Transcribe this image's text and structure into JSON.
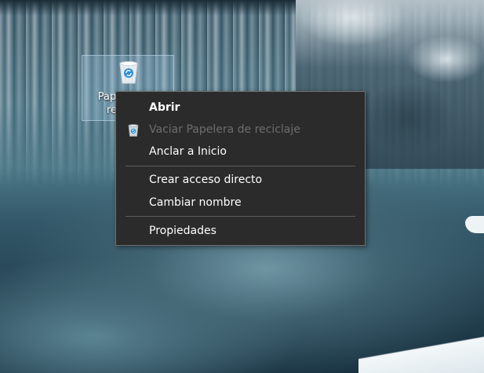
{
  "desktop": {
    "icon": {
      "name": "recycle-bin",
      "label": "Papelera de reciclaje"
    }
  },
  "context_menu": {
    "items": [
      {
        "label": "Abrir",
        "bold": true,
        "enabled": true
      },
      {
        "label": "Vaciar Papelera de reciclaje",
        "enabled": false,
        "icon": "recycle-bin-icon"
      },
      {
        "label": "Anclar a Inicio",
        "enabled": true
      },
      {
        "label": "Crear acceso directo",
        "enabled": true
      },
      {
        "label": "Cambiar nombre",
        "enabled": true
      },
      {
        "label": "Propiedades",
        "enabled": true
      }
    ]
  },
  "colors": {
    "menu_background": "#2b2b2b",
    "menu_border": "#6e6e6e",
    "menu_text": "#ffffff",
    "menu_text_disabled": "#6d6d6d",
    "separator": "#5f5f5f",
    "icon_selection": "#a0c8e6"
  }
}
